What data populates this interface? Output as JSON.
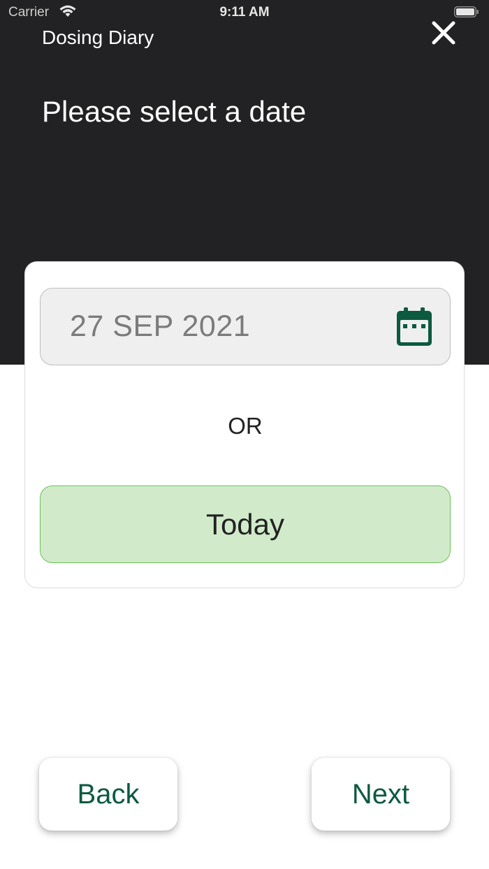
{
  "status_bar": {
    "carrier": "Carrier",
    "time": "9:11 AM",
    "icons": [
      "wifi-icon",
      "battery-icon"
    ]
  },
  "header": {
    "app_title": "Dosing Diary",
    "close_icon": "close-icon",
    "prompt": "Please select a date"
  },
  "date_picker": {
    "value": "27 SEP 2021",
    "icon": "calendar-icon",
    "or_label": "OR",
    "today_label": "Today"
  },
  "footer": {
    "back_label": "Back",
    "next_label": "Next"
  },
  "colors": {
    "header_bg": "#222224",
    "accent_green": "#0c5a40",
    "today_bg": "#d1ebca",
    "today_border": "#6cc05a",
    "field_bg": "#efefef"
  }
}
